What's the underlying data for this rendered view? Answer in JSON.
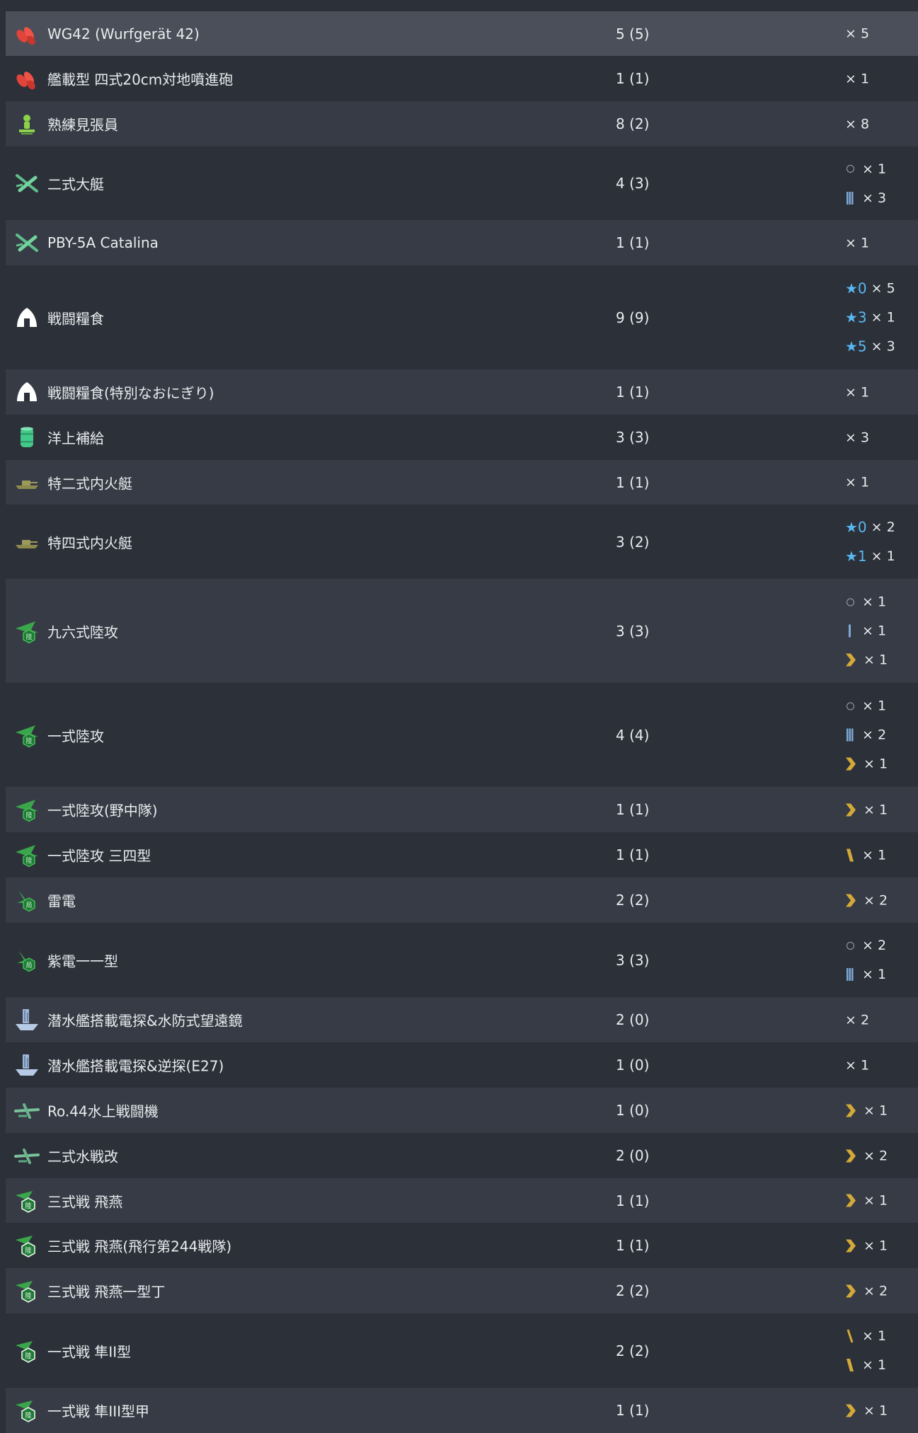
{
  "rows": [
    {
      "icon": "rocket-icon",
      "name": "WG42 (Wurfgerät 42)",
      "count": "5 (5)",
      "quals": [
        {
          "mark": "none",
          "times": "× 5"
        }
      ]
    },
    {
      "icon": "rocket-icon",
      "name": "艦載型 四式20cm対地噴進砲",
      "count": "1 (1)",
      "quals": [
        {
          "mark": "none",
          "times": "× 1"
        }
      ]
    },
    {
      "icon": "lookout-icon",
      "name": "熟練見張員",
      "count": "8 (2)",
      "quals": [
        {
          "mark": "none",
          "times": "× 8"
        }
      ]
    },
    {
      "icon": "flying-boat-icon",
      "name": "二式大艇",
      "count": "4 (3)",
      "quals": [
        {
          "mark": "ring",
          "times": "× 1"
        },
        {
          "mark": "bars3",
          "times": "× 3"
        }
      ]
    },
    {
      "icon": "flying-boat-icon",
      "name": "PBY-5A Catalina",
      "count": "1 (1)",
      "quals": [
        {
          "mark": "none",
          "times": "× 1"
        }
      ]
    },
    {
      "icon": "ration-icon",
      "name": "戦闘糧食",
      "count": "9 (9)",
      "quals": [
        {
          "mark": "star",
          "star": "★0",
          "times": "× 5"
        },
        {
          "mark": "star",
          "star": "★3",
          "times": "× 1"
        },
        {
          "mark": "star",
          "star": "★5",
          "times": "× 3"
        }
      ]
    },
    {
      "icon": "ration-icon",
      "name": "戦闘糧食(特別なおにぎり)",
      "count": "1 (1)",
      "quals": [
        {
          "mark": "none",
          "times": "× 1"
        }
      ]
    },
    {
      "icon": "drum-icon",
      "name": "洋上補給",
      "count": "3 (3)",
      "quals": [
        {
          "mark": "none",
          "times": "× 3"
        }
      ]
    },
    {
      "icon": "tank-icon",
      "name": "特二式内火艇",
      "count": "1 (1)",
      "quals": [
        {
          "mark": "none",
          "times": "× 1"
        }
      ]
    },
    {
      "icon": "tank-icon",
      "name": "特四式内火艇",
      "count": "3 (2)",
      "quals": [
        {
          "mark": "star",
          "star": "★0",
          "times": "× 2"
        },
        {
          "mark": "star",
          "star": "★1",
          "times": "× 1"
        }
      ]
    },
    {
      "icon": "land-attacker-icon",
      "name": "九六式陸攻",
      "count": "3 (3)",
      "quals": [
        {
          "mark": "ring",
          "times": "× 1"
        },
        {
          "mark": "bar1",
          "times": "× 1"
        },
        {
          "mark": "chevron",
          "times": "× 1"
        }
      ]
    },
    {
      "icon": "land-attacker-icon",
      "name": "一式陸攻",
      "count": "4 (4)",
      "quals": [
        {
          "mark": "ring",
          "times": "× 1"
        },
        {
          "mark": "bars3",
          "times": "× 2"
        },
        {
          "mark": "chevron",
          "times": "× 1"
        }
      ]
    },
    {
      "icon": "land-attacker-icon",
      "name": "一式陸攻(野中隊)",
      "count": "1 (1)",
      "quals": [
        {
          "mark": "chevron",
          "times": "× 1"
        }
      ]
    },
    {
      "icon": "land-attacker-icon",
      "name": "一式陸攻 三四型",
      "count": "1 (1)",
      "quals": [
        {
          "mark": "slash2",
          "times": "× 1"
        }
      ]
    },
    {
      "icon": "interceptor-icon",
      "name": "雷電",
      "count": "2 (2)",
      "quals": [
        {
          "mark": "chevron",
          "times": "× 2"
        }
      ]
    },
    {
      "icon": "interceptor-icon",
      "name": "紫電一一型",
      "count": "3 (3)",
      "quals": [
        {
          "mark": "ring",
          "times": "× 2"
        },
        {
          "mark": "bars3",
          "times": "× 1"
        }
      ]
    },
    {
      "icon": "submarine-equip-icon",
      "name": "潜水艦搭載電探&水防式望遠鏡",
      "count": "2 (0)",
      "quals": [
        {
          "mark": "none",
          "times": "× 2"
        }
      ]
    },
    {
      "icon": "submarine-equip-icon",
      "name": "潜水艦搭載電探&逆探(E27)",
      "count": "1 (0)",
      "quals": [
        {
          "mark": "none",
          "times": "× 1"
        }
      ]
    },
    {
      "icon": "seaplane-fighter-icon",
      "name": "Ro.44水上戦闘機",
      "count": "1 (0)",
      "quals": [
        {
          "mark": "chevron",
          "times": "× 1"
        }
      ]
    },
    {
      "icon": "seaplane-fighter-icon",
      "name": "二式水戦改",
      "count": "2 (0)",
      "quals": [
        {
          "mark": "chevron",
          "times": "× 2"
        }
      ]
    },
    {
      "icon": "land-fighter-icon",
      "name": "三式戦 飛燕",
      "count": "1 (1)",
      "quals": [
        {
          "mark": "chevron",
          "times": "× 1"
        }
      ]
    },
    {
      "icon": "land-fighter-icon",
      "name": "三式戦 飛燕(飛行第244戦隊)",
      "count": "1 (1)",
      "quals": [
        {
          "mark": "chevron",
          "times": "× 1"
        }
      ]
    },
    {
      "icon": "land-fighter-icon",
      "name": "三式戦 飛燕一型丁",
      "count": "2 (2)",
      "quals": [
        {
          "mark": "chevron",
          "times": "× 2"
        }
      ]
    },
    {
      "icon": "land-fighter-icon",
      "name": "一式戦 隼II型",
      "count": "2 (2)",
      "quals": [
        {
          "mark": "slash1",
          "times": "× 1"
        },
        {
          "mark": "slash2",
          "times": "× 1"
        }
      ]
    },
    {
      "icon": "land-fighter-icon",
      "name": "一式戦 隼III型甲",
      "count": "1 (1)",
      "quals": [
        {
          "mark": "chevron",
          "times": "× 1"
        }
      ]
    }
  ],
  "colors": {
    "row_odd": "#363b45",
    "row_even": "#2c3039",
    "row_highlight": "#4a4f59",
    "star": "#59b8f2",
    "proficiency_blue": "#7ea9d8",
    "proficiency_gold": "#d3a93a"
  }
}
